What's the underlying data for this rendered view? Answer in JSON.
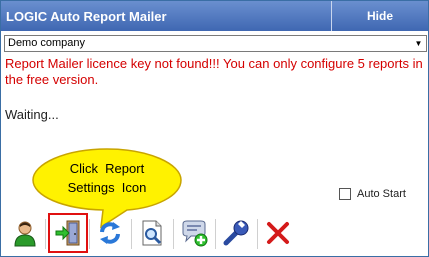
{
  "window": {
    "title": "LOGIC Auto Report Mailer",
    "hide_label": "Hide"
  },
  "company_select": {
    "selected": "Demo company"
  },
  "licence_message": "Report Mailer licence key not found!!! You can only configure 5 reports in the free version.",
  "status": "Waiting...",
  "callout": {
    "line1": "Click  Report",
    "line2": "Settings  Icon"
  },
  "auto_start": {
    "label": "Auto Start",
    "checked": false
  },
  "toolbar": {
    "icons": [
      "user-icon",
      "report-settings-icon",
      "refresh-icon",
      "preview-icon",
      "add-message-icon",
      "wrench-icon",
      "close-icon"
    ]
  },
  "colors": {
    "title_bar": "#4a72b8",
    "error_text": "#d40000",
    "callout_fill": "#fff200",
    "highlight_border": "#e01010"
  }
}
